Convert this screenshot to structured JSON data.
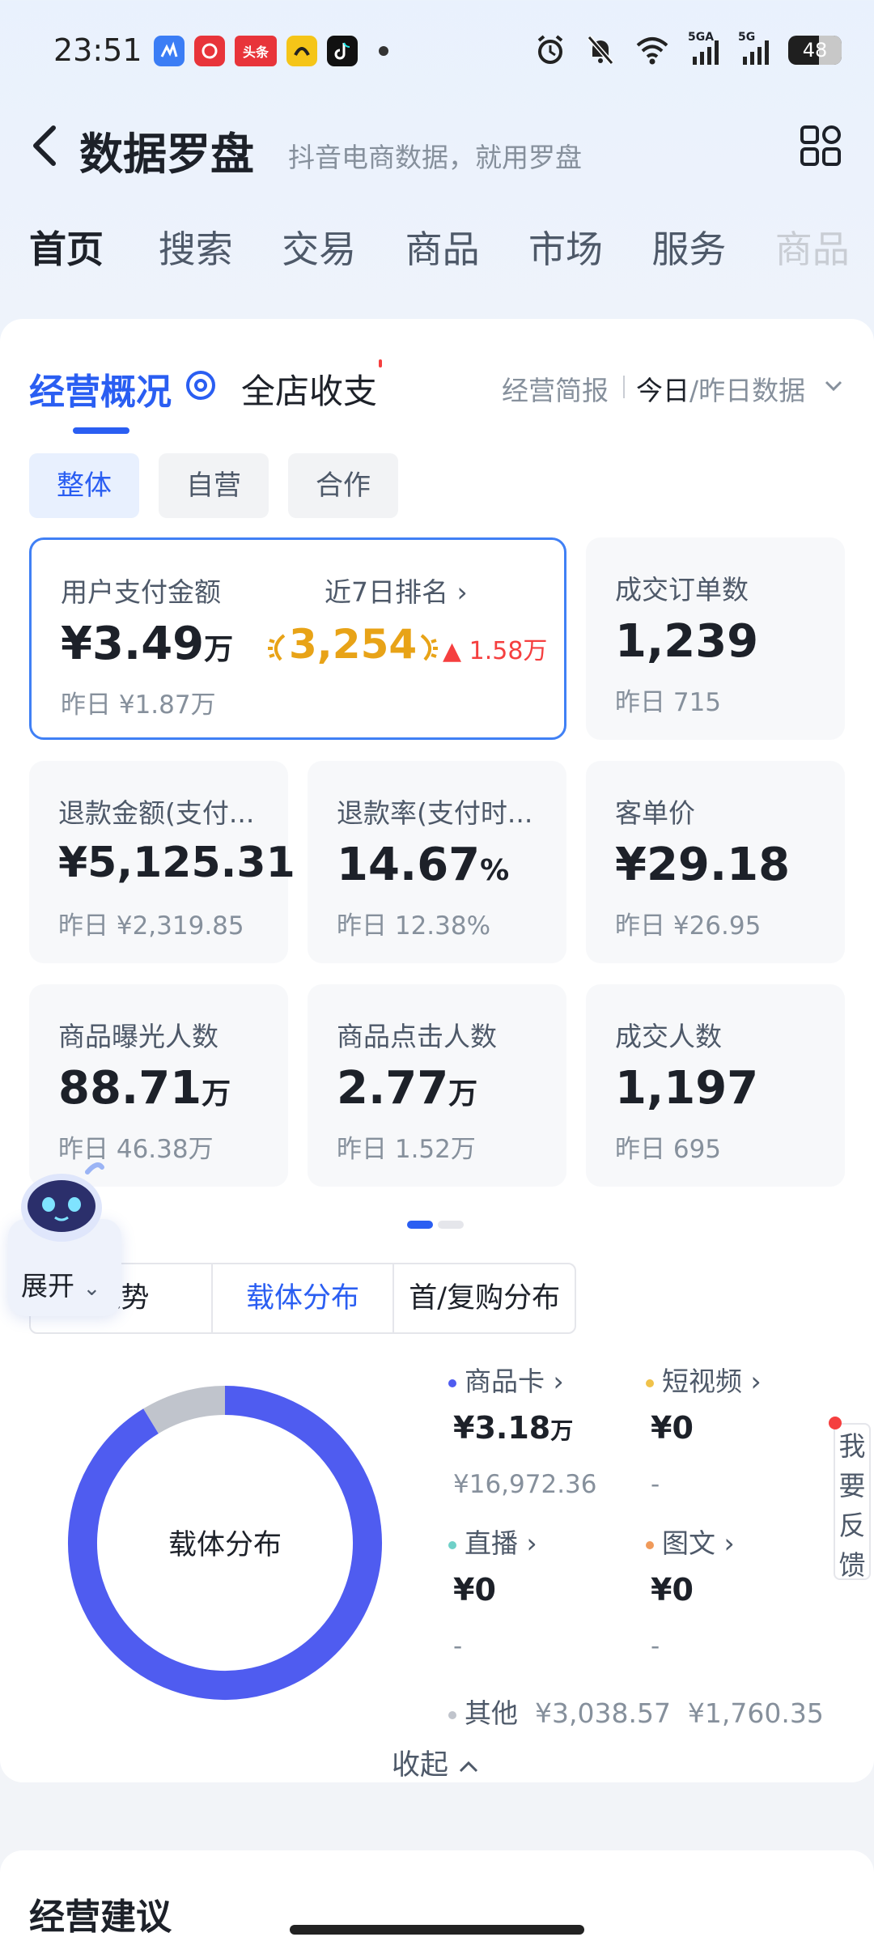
{
  "status_bar": {
    "time": "23:51",
    "apps": [
      {
        "name": "app-icon-1",
        "color": "#3b7df5",
        "text": ""
      },
      {
        "name": "netease-music-icon",
        "color": "#e8343a",
        "text": ""
      },
      {
        "name": "toutiao-icon",
        "color": "#e8343a",
        "text": "头条"
      },
      {
        "name": "app-icon-yellow",
        "color": "#f5c518",
        "text": ""
      },
      {
        "name": "douyin-icon",
        "color": "#111111",
        "text": ""
      }
    ],
    "battery": "48",
    "network1": "5GA",
    "network2": "5G"
  },
  "header": {
    "title": "数据罗盘",
    "subtitle": "抖音电商数据，就用罗盘"
  },
  "nav_tabs": [
    {
      "label": "首页",
      "active": true
    },
    {
      "label": "搜索"
    },
    {
      "label": "交易"
    },
    {
      "label": "商品"
    },
    {
      "label": "市场"
    },
    {
      "label": "服务"
    },
    {
      "label": "商品"
    }
  ],
  "section": {
    "tab_active": "经营概况",
    "tab_other": "全店收支",
    "brief_label": "经营简报",
    "brief_today": "今日",
    "brief_rest": "/昨日数据"
  },
  "pills": [
    "整体",
    "自营",
    "合作"
  ],
  "metrics": {
    "pay_amount": {
      "label": "用户支付金额",
      "value": "¥3.49",
      "unit": "万",
      "yesterday": "昨日 ¥1.87万",
      "rank_link": "近7日排名 ›",
      "rank": "3,254",
      "rank_change": "▲ 1.58万"
    },
    "orders": {
      "label": "成交订单数",
      "value": "1,239",
      "yesterday": "昨日 715"
    },
    "refund_amount": {
      "label": "退款金额(支付...",
      "value": "¥5,125.31",
      "yesterday": "昨日 ¥2,319.85"
    },
    "refund_rate": {
      "label": "退款率(支付时...",
      "value": "14.67",
      "unit": "%",
      "yesterday": "昨日 12.38%"
    },
    "avg_price": {
      "label": "客单价",
      "value": "¥29.18",
      "yesterday": "昨日 ¥26.95"
    },
    "exposure": {
      "label": "商品曝光人数",
      "value": "88.71",
      "unit": "万",
      "yesterday": "昨日 46.38万"
    },
    "clicks": {
      "label": "商品点击人数",
      "value": "2.77",
      "unit": "万",
      "yesterday": "昨日 1.52万"
    },
    "buyers": {
      "label": "成交人数",
      "value": "1,197",
      "yesterday": "昨日 695"
    }
  },
  "robot": {
    "label": "展开"
  },
  "sub_tabs": [
    {
      "label": "趋势"
    },
    {
      "label": "载体分布",
      "active": true
    },
    {
      "label": "首/复购分布"
    }
  ],
  "distribution": {
    "center_label": "载体分布",
    "items": [
      {
        "name": "商品卡 ›",
        "color": "#4f5cf0",
        "value": "¥3.18",
        "unit": "万",
        "sub": "¥16,972.36"
      },
      {
        "name": "短视频 ›",
        "color": "#f0c24a",
        "value": "¥0",
        "unit": "",
        "sub": "-"
      },
      {
        "name": "直播 ›",
        "color": "#6fd0c8",
        "value": "¥0",
        "unit": "",
        "sub": "-"
      },
      {
        "name": "图文 ›",
        "color": "#f09a5a",
        "value": "¥0",
        "unit": "",
        "sub": "-"
      }
    ],
    "other": {
      "name": "其他",
      "color": "#c0c4cc",
      "value1": "¥3,038.57",
      "value2": "¥1,760.35"
    },
    "share": {
      "商品卡": 0.913,
      "其他": 0.087
    }
  },
  "feedback": [
    "我",
    "要",
    "反",
    "馈"
  ],
  "collapse": "收起",
  "next_section": "经营建议",
  "colors": {
    "accent": "#2a5ef2",
    "rank_gold": "#e8a317",
    "up_red": "#f53f3f"
  }
}
